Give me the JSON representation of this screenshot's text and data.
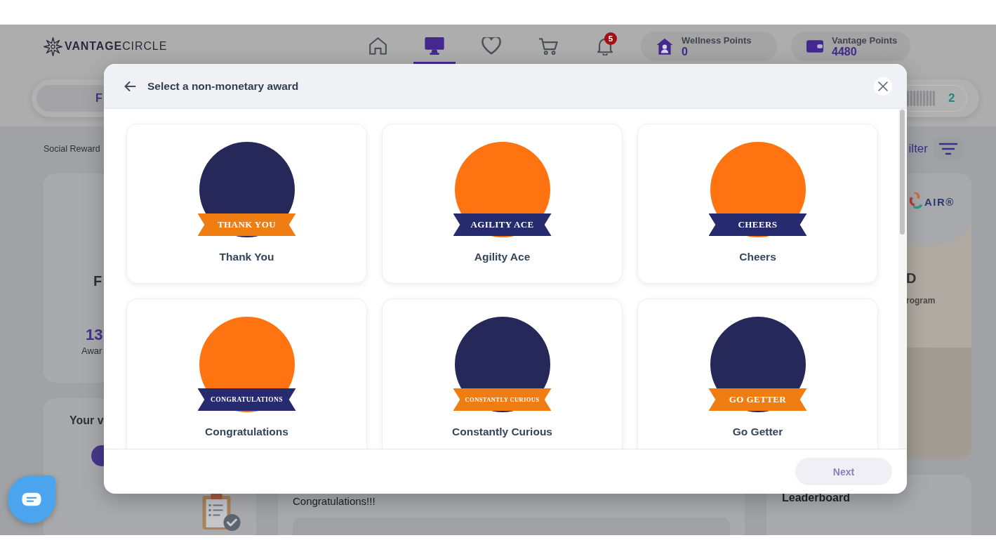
{
  "header": {
    "logo": "**VANTAGE**CIRCLE",
    "nav": [
      {
        "kind": "home",
        "selected": false
      },
      {
        "kind": "monitor",
        "selected": true
      },
      {
        "kind": "heart",
        "selected": false
      },
      {
        "kind": "cart",
        "selected": false
      },
      {
        "kind": "bell",
        "selected": false,
        "badge": "5"
      }
    ],
    "points": [
      {
        "kind": "wellness",
        "label": "Wellness Points",
        "value": "0"
      },
      {
        "kind": "wallet",
        "label": "Vantage Points",
        "value": "4480"
      }
    ]
  },
  "tab_bar": {
    "tab": "F",
    "count": "2"
  },
  "left_column": {
    "breadcrumb": "Social Reward",
    "summary_card": {
      "title": "F",
      "value": "13",
      "caption": "Awar"
    },
    "second_card": {
      "title": "Your v"
    }
  },
  "right_column": {
    "filter": "ilter",
    "program_card": {
      "logo": "AIR®",
      "title": "D",
      "subtitle": "rogram"
    },
    "leaderboard": {
      "title": "Leaderboard"
    }
  },
  "feed_card": {
    "text": "Congratulations!!!"
  },
  "modal": {
    "title": "Select a non-monetary award",
    "awards": [
      {
        "name": "Thank You",
        "color": "#252859",
        "ribbon": {
          "text": "THANK YOU",
          "color": "#f07d12"
        },
        "selected": false
      },
      {
        "name": "Agility Ace",
        "color": "#ff7310",
        "ribbon": {
          "text": "AGILITY ACE",
          "color": "#262a6e"
        },
        "selected": false
      },
      {
        "name": "Cheers",
        "color": "#ff7310",
        "ribbon": {
          "text": "CHEERS",
          "color": "#262a6e"
        },
        "selected": false
      },
      {
        "name": "Congratulations",
        "color": "#ff7310",
        "ribbon": {
          "text": "CONGRATULATIONS",
          "color": "#262a6e"
        },
        "selected": false
      },
      {
        "name": "Constantly Curious",
        "color": "#252859",
        "ribbon": {
          "text": "CONSTANTLY CURIOUS",
          "color": "#f07d12"
        },
        "selected": false
      },
      {
        "name": "Go Getter",
        "color": "#252859",
        "ribbon": {
          "text": "GO GETTER",
          "color": "#f07d12"
        },
        "selected": false
      }
    ],
    "next_button": {
      "label": "Next",
      "disabled": true
    }
  }
}
